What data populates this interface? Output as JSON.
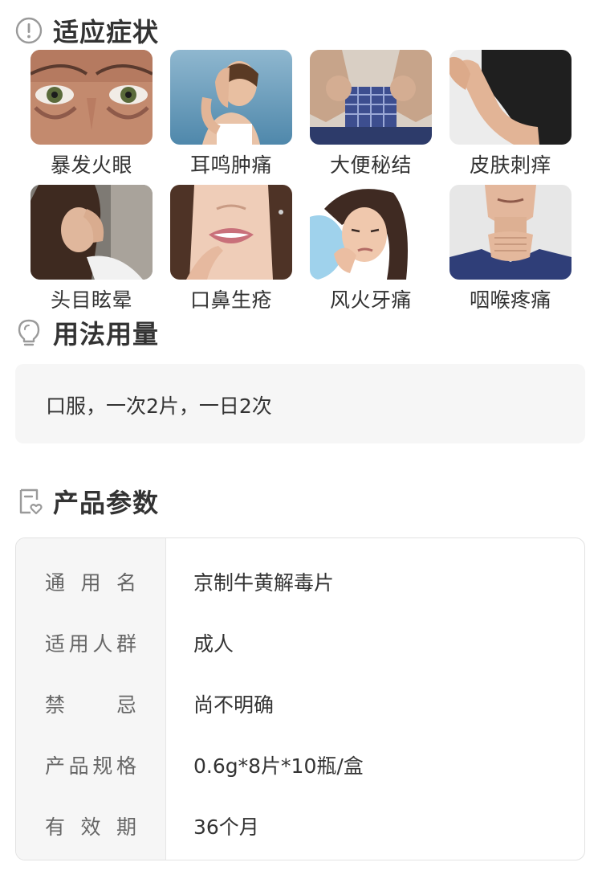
{
  "indications": {
    "title": "适应症状",
    "icon": "exclamation-circle-icon",
    "items": [
      {
        "label": "暴发火眼"
      },
      {
        "label": "耳鸣肿痛"
      },
      {
        "label": "大便秘结"
      },
      {
        "label": "皮肤刺痒"
      },
      {
        "label": "头目眩晕"
      },
      {
        "label": "口鼻生疮"
      },
      {
        "label": "风火牙痛"
      },
      {
        "label": "咽喉疼痛"
      }
    ]
  },
  "usage": {
    "title": "用法用量",
    "icon": "lightbulb-icon",
    "text": "口服，一次2片，一日2次"
  },
  "params": {
    "title": "产品参数",
    "icon": "product-tag-icon",
    "rows": [
      {
        "label": "通用名",
        "value": "京制牛黄解毒片"
      },
      {
        "label": "适用人群",
        "value": "成人"
      },
      {
        "label": "禁忌",
        "value": "尚不明确"
      },
      {
        "label": "产品规格",
        "value": "0.6g*8片*10瓶/盒"
      },
      {
        "label": "有效期",
        "value": "36个月"
      }
    ]
  },
  "colors": {
    "heading": "#333333",
    "icon_gray": "#999999",
    "box_bg": "#f6f6f6",
    "border": "#e2e2e2"
  }
}
